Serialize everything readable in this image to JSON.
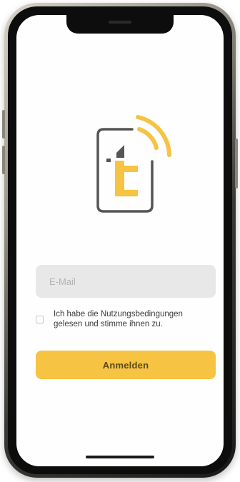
{
  "login": {
    "email_placeholder": "E-Mail",
    "email_value": "",
    "terms_label": "Ich habe die Nutzungsbedingungen gelesen und stimme ihnen zu.",
    "terms_checked": false,
    "submit_label": "Anmelden"
  },
  "colors": {
    "accent": "#f6c342",
    "logo_gray": "#555555",
    "field_bg": "#e8e8e8"
  },
  "icons": {
    "app_logo": "app-logo-icon",
    "checkbox": "checkbox-icon"
  }
}
